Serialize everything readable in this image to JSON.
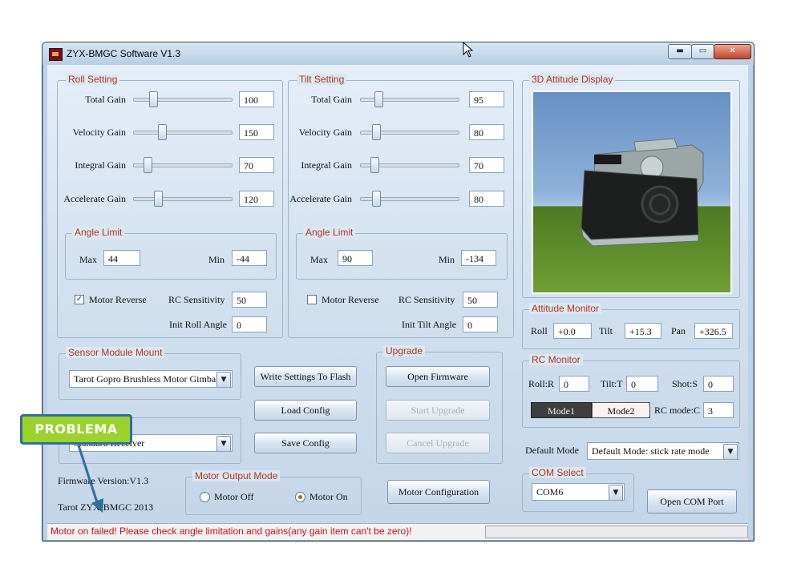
{
  "window": {
    "title": "ZYX-BMGC Software V1.3",
    "min_label": "▬",
    "max_label": "▭",
    "close_label": "✕"
  },
  "roll": {
    "legend": "Roll Setting",
    "rows": [
      {
        "label": "Total Gain",
        "value": "100",
        "slider": 0.2
      },
      {
        "label": "Velocity Gain",
        "value": "150",
        "slider": 0.3
      },
      {
        "label": "Integral Gain",
        "value": "70",
        "slider": 0.14
      },
      {
        "label": "Accelerate Gain",
        "value": "120",
        "slider": 0.25
      }
    ],
    "angle_legend": "Angle Limit",
    "max_label": "Max",
    "max_value": "44",
    "min_label": "Min",
    "min_value": "-44",
    "motor_reverse_label": "Motor Reverse",
    "motor_reverse_checked": true,
    "rc_sensitivity_label": "RC Sensitivity",
    "rc_sensitivity_value": "50",
    "init_angle_label": "Init Roll Angle",
    "init_angle_value": "0"
  },
  "tilt": {
    "legend": "Tilt Setting",
    "rows": [
      {
        "label": "Total Gain",
        "value": "95",
        "slider": 0.19
      },
      {
        "label": "Velocity Gain",
        "value": "80",
        "slider": 0.16
      },
      {
        "label": "Integral Gain",
        "value": "70",
        "slider": 0.14
      },
      {
        "label": "Accelerate Gain",
        "value": "80",
        "slider": 0.16
      }
    ],
    "angle_legend": "Angle Limit",
    "max_label": "Max",
    "max_value": "90",
    "min_label": "Min",
    "min_value": "-134",
    "motor_reverse_label": "Motor Reverse",
    "motor_reverse_checked": false,
    "rc_sensitivity_label": "RC Sensitivity",
    "rc_sensitivity_value": "50",
    "init_angle_label": "Init Tilt Angle",
    "init_angle_value": "0"
  },
  "attitude_display": {
    "legend": "3D Attitude Display"
  },
  "attitude_monitor": {
    "legend": "Attitude Monitor",
    "roll_label": "Roll",
    "roll_value": "+0.0",
    "tilt_label": "Tilt",
    "tilt_value": "+15.3",
    "pan_label": "Pan",
    "pan_value": "+326.5"
  },
  "rc_monitor": {
    "legend": "RC Monitor",
    "roll_label": "Roll:R",
    "roll_value": "0",
    "tilt_label": "Tilt:T",
    "tilt_value": "0",
    "shot_label": "Shot:S",
    "shot_value": "0",
    "mode1_label": "Mode1",
    "mode2_label": "Mode2",
    "rc_mode_label": "RC mode:C",
    "rc_mode_value": "3"
  },
  "default_mode": {
    "label": "Default Mode",
    "value": "Default Mode: stick rate mode"
  },
  "sensor_mount": {
    "legend": "Sensor Module Mount",
    "value": "Tarot Gopro Brushless Motor Gimbal"
  },
  "receiver": {
    "value": "Standard Receiver"
  },
  "buttons": {
    "write_flash": "Write Settings To Flash",
    "load_config": "Load Config",
    "save_config": "Save Config",
    "motor_configuration": "Motor Configuration",
    "open_com": "Open COM Port"
  },
  "upgrade": {
    "legend": "Upgrade",
    "open_firmware": "Open Firmware",
    "start_upgrade": "Start Upgrade",
    "cancel_upgrade": "Cancel Upgrade"
  },
  "firmware": {
    "version": "Firmware Version:V1.3",
    "copyright": "Tarot ZYX-BMGC 2013"
  },
  "motor_output": {
    "legend": "Motor Output Mode",
    "off_label": "Motor Off",
    "on_label": "Motor On",
    "selected": "on"
  },
  "com_select": {
    "legend": "COM Select",
    "value": "COM6"
  },
  "status": {
    "message": "Motor on failed! Please check angle limitation and gains(any gain item can't be zero)!"
  },
  "annotation": {
    "label": "PROBLEMA"
  },
  "colors": {
    "legend_text": "#b1371b",
    "status_error": "#d01010",
    "callout_fill": "#9bd22e",
    "callout_border": "#2f6f9c"
  }
}
